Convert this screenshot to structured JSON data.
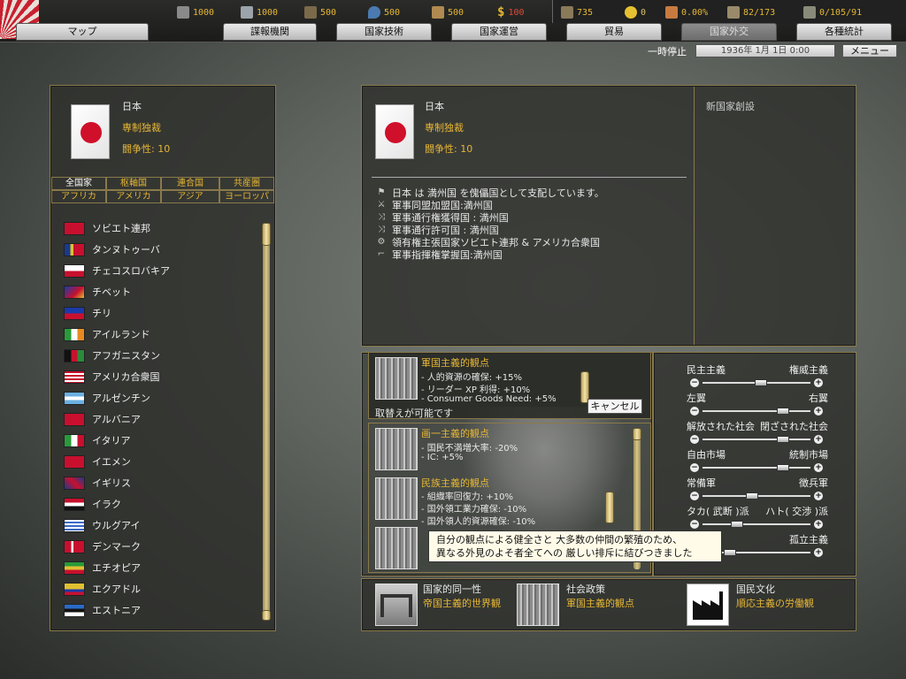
{
  "resources": {
    "energy": "1000",
    "metal": "1000",
    "rare": "500",
    "oil": "500",
    "supplies": "500",
    "money": "100",
    "manpower": "735",
    "nuclear": "0",
    "dissent": "0.00%",
    "transport": "82/173",
    "convoys": "0/105/91"
  },
  "tabs": [
    "マップ",
    "諜報機関",
    "国家技術",
    "国家運営",
    "貿易",
    "国家外交",
    "各種統計"
  ],
  "status": {
    "pause_label": "一時停止",
    "date": "1936年 1月 1日 0:00",
    "menu_label": "メニュー"
  },
  "country": {
    "name": "日本",
    "government": "専制独裁",
    "belligerence": "闘争性: 10"
  },
  "filters": {
    "row1": [
      "全国家",
      "枢軸国",
      "連合国",
      "共産圏"
    ],
    "row2": [
      "アフリカ",
      "アメリカ",
      "アジア",
      "ヨーロッパ"
    ]
  },
  "countries": [
    "ソビエト連邦",
    "タンヌトゥーバ",
    "チェコスロバキア",
    "チベット",
    "チリ",
    "アイルランド",
    "アフガニスタン",
    "アメリカ合衆国",
    "アルゼンチン",
    "アルバニア",
    "イタリア",
    "イエメン",
    "イギリス",
    "イラク",
    "ウルグアイ",
    "デンマーク",
    "エチオピア",
    "エクアドル",
    "エストニア"
  ],
  "new_nation": "新国家創設",
  "relations": [
    "日本 は 満州国 を傀儡国として支配しています。",
    "軍事同盟加盟国:満州国",
    "軍事通行権獲得国 : 満州国",
    "軍事通行許可国 : 満州国",
    "領有権主張国家ソビエト連邦 & アメリカ合衆国",
    "軍事指揮権掌握国:満州国"
  ],
  "policies": {
    "p1": {
      "title": "軍国主義的観点",
      "lines": [
        "- 人的資源の確保: +15%",
        "- リーダー XP 利得: +10%",
        "- Consumer Goods Need: +5%"
      ],
      "status": "取替えが可能です",
      "cancel": "キャンセル"
    },
    "p2": {
      "title": "画一主義的観点",
      "lines": [
        "- 国民不満増大率: -20%",
        "- IC: +5%"
      ]
    },
    "p3": {
      "title": "民族主義的観点",
      "lines": [
        "- 組織率回復力: +10%",
        "- 国外領工業力確保: -10%",
        "- 国外領人的資源確保: -10%"
      ]
    }
  },
  "tooltip": {
    "line1": "自分の観点による健全さと 大多数の仲間の繁殖のため、",
    "line2": "異なる外見のよそ者全てへの 厳しい排斥に結びつきました"
  },
  "sliders": [
    {
      "left": "民主主義",
      "right": "権威主義",
      "level": 0.55
    },
    {
      "left": "左翼",
      "right": "右翼",
      "level": 0.78
    },
    {
      "left": "解放された社会",
      "right": "閉ざされた社会",
      "level": 0.78
    },
    {
      "left": "自由市場",
      "right": "統制市場",
      "level": 0.78
    },
    {
      "left": "常備軍",
      "right": "徴兵軍",
      "level": 0.45
    },
    {
      "left": "タカ( 武断 )派",
      "right": "ハト( 交渉 )派",
      "level": 0.3
    },
    {
      "left": "",
      "right": "孤立主義",
      "level": 0.22
    }
  ],
  "bottom": [
    {
      "label": "国家的同一性",
      "value": "帝国主義的世界観"
    },
    {
      "label": "社会政策",
      "value": "軍国主義的観点"
    },
    {
      "label": "国民文化",
      "value": "順応主義の労働観"
    }
  ]
}
